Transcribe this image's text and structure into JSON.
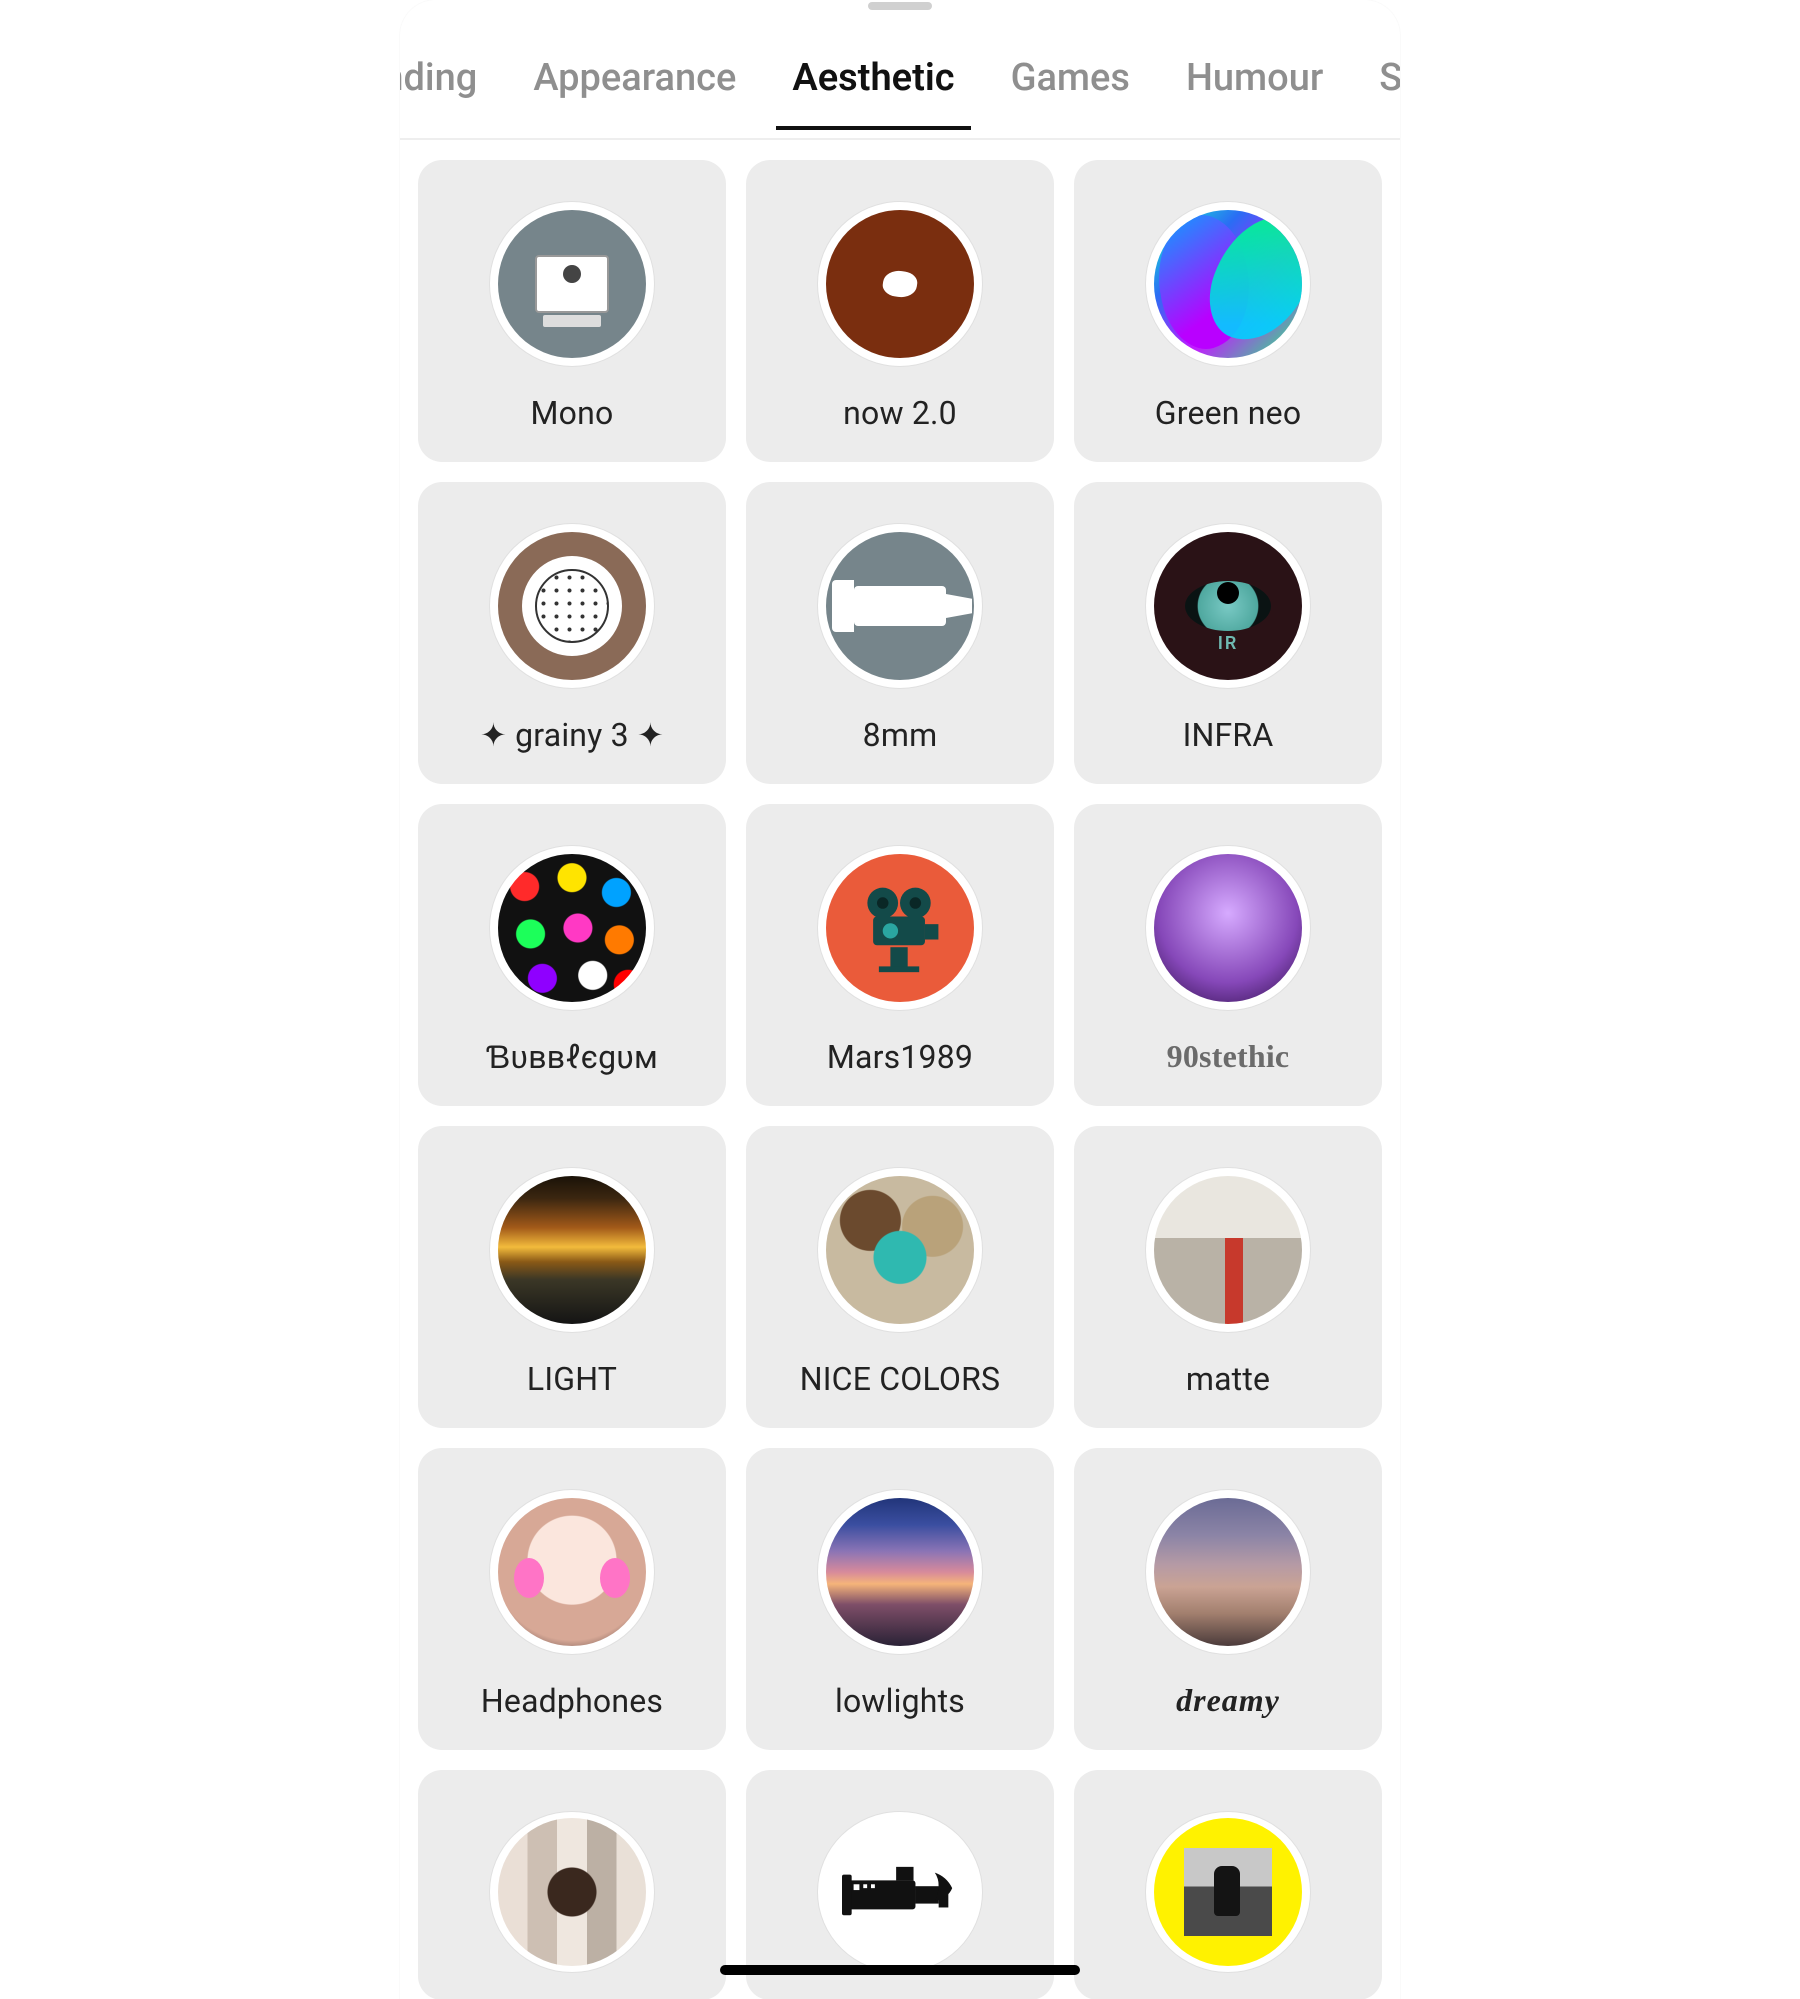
{
  "tabs": {
    "items": [
      {
        "label": "ending"
      },
      {
        "label": "Appearance"
      },
      {
        "label": "Aesthetic"
      },
      {
        "label": "Games"
      },
      {
        "label": "Humour"
      },
      {
        "label": "S"
      }
    ],
    "activeIndex": 2
  },
  "filters": [
    {
      "label": "Mono",
      "icon": "mono"
    },
    {
      "label": "now 2.0",
      "icon": "now20"
    },
    {
      "label": "Green neo",
      "icon": "greenneo"
    },
    {
      "label": "✦ grainy 3 ✦",
      "icon": "grainy3"
    },
    {
      "label": "8mm",
      "icon": "8mm"
    },
    {
      "label": "INFRA",
      "icon": "infra",
      "infraText": "IR"
    },
    {
      "label": "Ɓʋввℓєgυм",
      "icon": "bubblegum"
    },
    {
      "label": "Mars1989",
      "icon": "mars1989"
    },
    {
      "label": "90stethic",
      "icon": "90s",
      "labelClass": "label-90s"
    },
    {
      "label": "LIGHT",
      "icon": "light"
    },
    {
      "label": "NICE COLORS",
      "icon": "nicecolors"
    },
    {
      "label": "matte",
      "icon": "matte"
    },
    {
      "label": "Headphones",
      "icon": "headphones"
    },
    {
      "label": "lowlights",
      "icon": "lowlights"
    },
    {
      "label": "dreamy",
      "icon": "dreamy",
      "labelClass": "label-dreamy"
    },
    {
      "label": "",
      "icon": "blur"
    },
    {
      "label": "",
      "icon": "filmcam"
    },
    {
      "label": "",
      "icon": "yellow"
    }
  ]
}
